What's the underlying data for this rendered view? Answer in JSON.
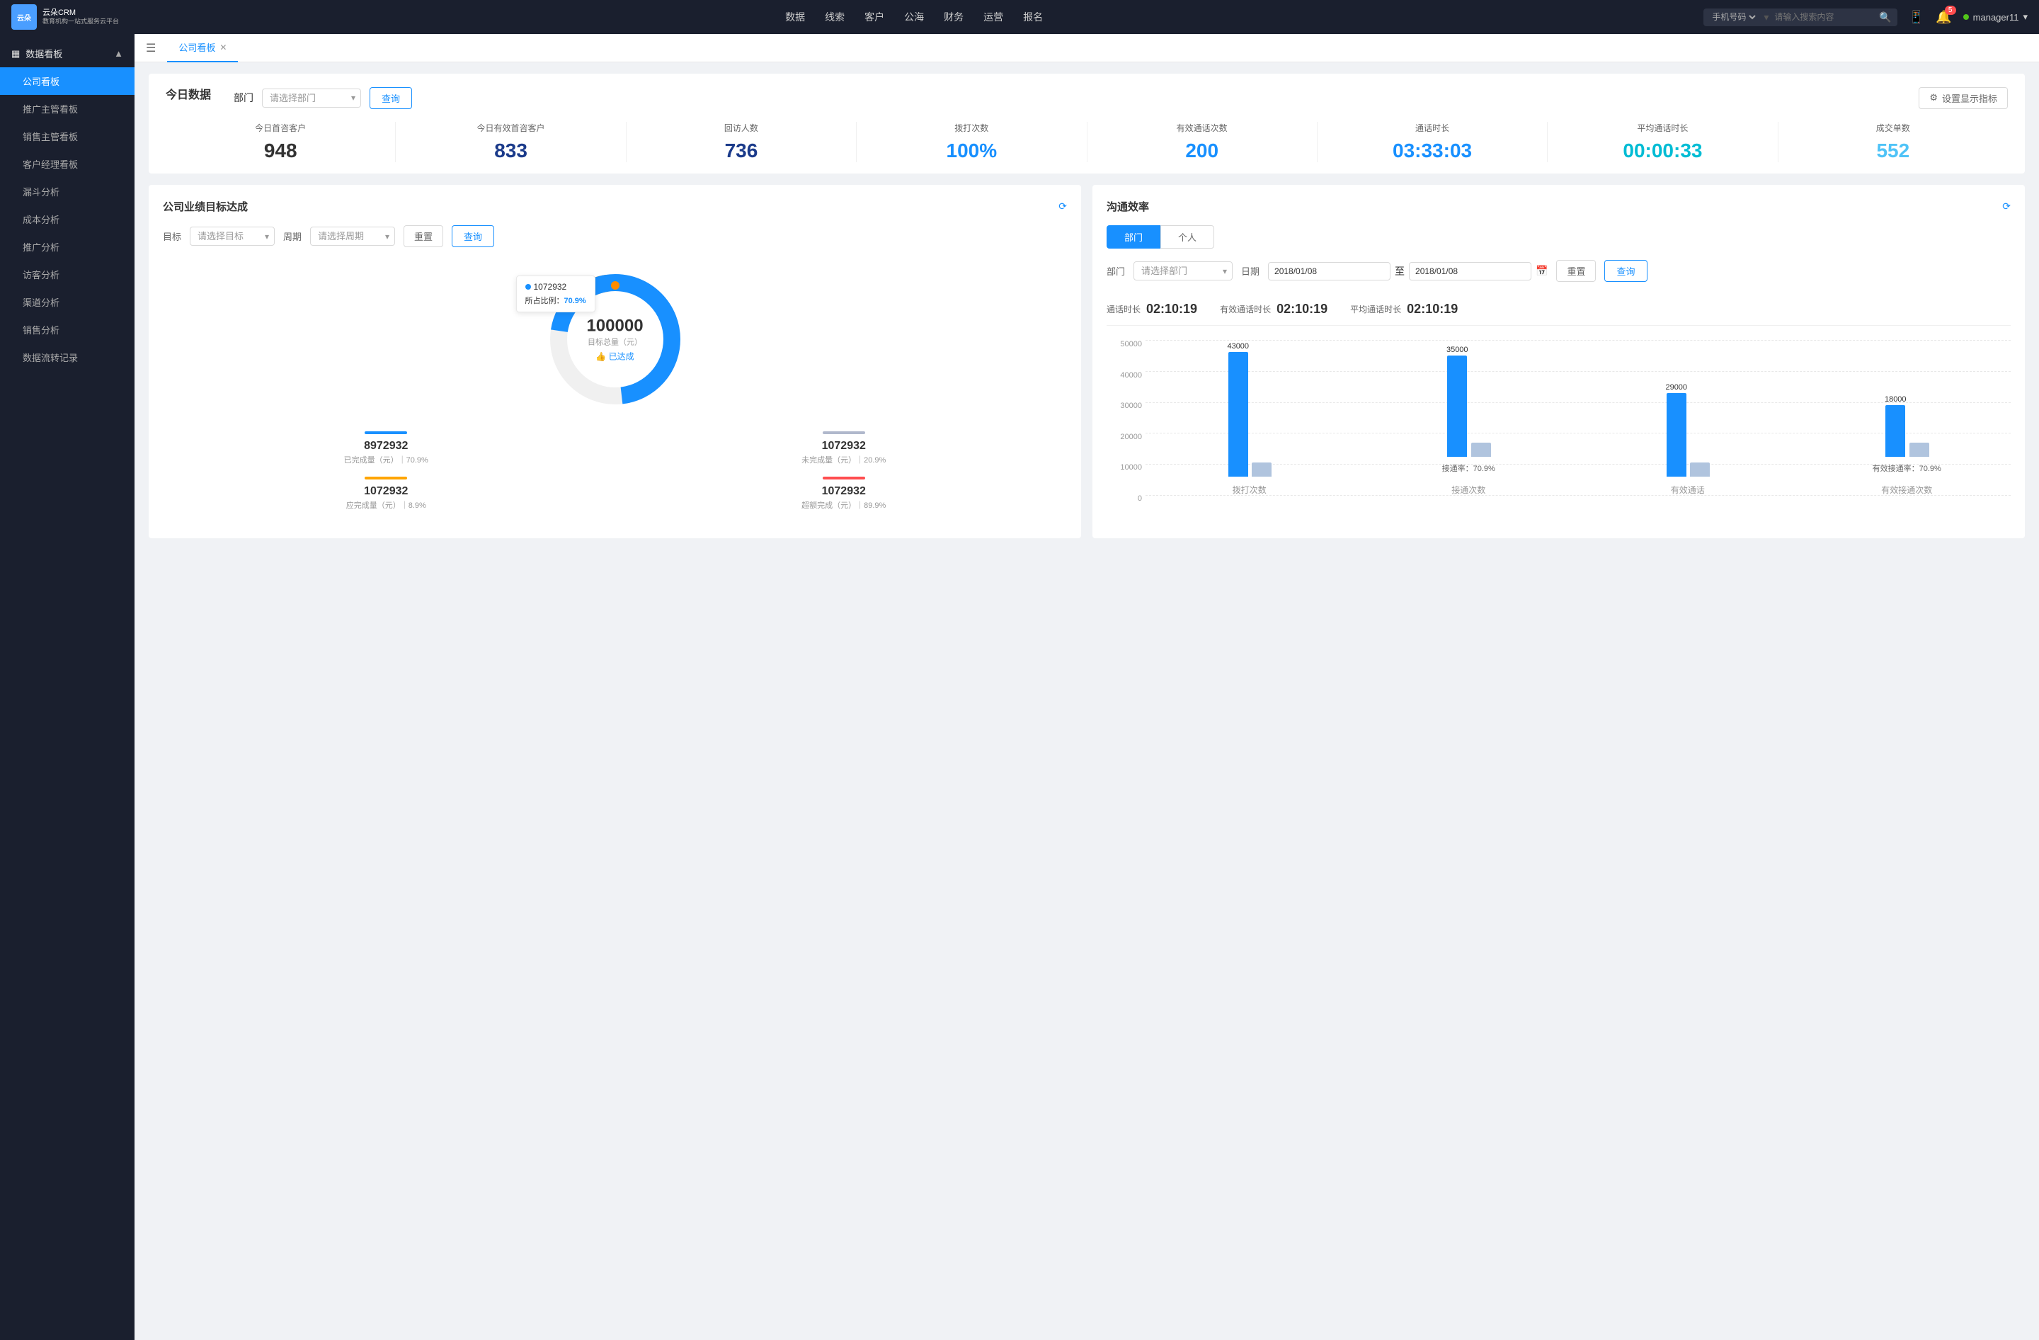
{
  "app": {
    "logo_text_line1": "云朵CRM",
    "logo_text_line2": "教育机构一站式服务云平台"
  },
  "top_nav": {
    "items": [
      "数据",
      "线索",
      "客户",
      "公海",
      "财务",
      "运营",
      "报名"
    ],
    "search_placeholder": "请输入搜索内容",
    "search_type": "手机号码",
    "notification_count": "5",
    "username": "manager11"
  },
  "sidebar": {
    "section_title": "数据看板",
    "items": [
      {
        "label": "公司看板",
        "active": true
      },
      {
        "label": "推广主管看板",
        "active": false
      },
      {
        "label": "销售主管看板",
        "active": false
      },
      {
        "label": "客户经理看板",
        "active": false
      },
      {
        "label": "漏斗分析",
        "active": false
      },
      {
        "label": "成本分析",
        "active": false
      },
      {
        "label": "推广分析",
        "active": false
      },
      {
        "label": "访客分析",
        "active": false
      },
      {
        "label": "渠道分析",
        "active": false
      },
      {
        "label": "销售分析",
        "active": false
      },
      {
        "label": "数据流转记录",
        "active": false
      }
    ]
  },
  "tab_bar": {
    "tabs": [
      {
        "label": "公司看板",
        "active": true
      }
    ]
  },
  "today_section": {
    "title": "今日数据",
    "dept_label": "部门",
    "dept_placeholder": "请选择部门",
    "query_btn": "查询",
    "settings_btn": "设置显示指标",
    "metrics": [
      {
        "label": "今日首咨客户",
        "value": "948",
        "color": "black"
      },
      {
        "label": "今日有效首咨客户",
        "value": "833",
        "color": "dark-blue"
      },
      {
        "label": "回访人数",
        "value": "736",
        "color": "dark-blue"
      },
      {
        "label": "拨打次数",
        "value": "100%",
        "color": "blue"
      },
      {
        "label": "有效通话次数",
        "value": "200",
        "color": "blue"
      },
      {
        "label": "通话时长",
        "value": "03:33:03",
        "color": "blue"
      },
      {
        "label": "平均通话时长",
        "value": "00:00:33",
        "color": "cyan"
      },
      {
        "label": "成交单数",
        "value": "552",
        "color": "light-blue"
      }
    ]
  },
  "target_panel": {
    "title": "公司业绩目标达成",
    "target_label": "目标",
    "target_placeholder": "请选择目标",
    "period_label": "周期",
    "period_placeholder": "请选择周期",
    "reset_btn": "重置",
    "query_btn": "查询",
    "donut": {
      "total": "100000",
      "total_label": "目标总量（元）",
      "achieved_label": "👍 已达成",
      "tooltip_value": "1072932",
      "tooltip_ratio_label": "所占比例：",
      "tooltip_ratio": "70.9%",
      "blue_pct": 70.9,
      "orange_pct": 9
    },
    "stats": [
      {
        "label": "已完成量（元）｜70.9%",
        "value": "8972932",
        "bar_color": "#1890ff"
      },
      {
        "label": "未完成量（元）｜20.9%",
        "value": "1072932",
        "bar_color": "#b0b8cc"
      },
      {
        "label": "应完成量（元）｜8.9%",
        "value": "1072932",
        "bar_color": "#ffa500"
      },
      {
        "label": "超额完成（元）｜89.9%",
        "value": "1072932",
        "bar_color": "#ff4d4f"
      }
    ]
  },
  "comm_panel": {
    "title": "沟通效率",
    "tabs": [
      "部门",
      "个人"
    ],
    "active_tab": 0,
    "dept_label": "部门",
    "dept_placeholder": "请选择部门",
    "date_label": "日期",
    "date_start": "2018/01/08",
    "date_end": "2018/01/08",
    "reset_btn": "重置",
    "query_btn": "查询",
    "stats": [
      {
        "label": "通话时长",
        "value": "02:10:19"
      },
      {
        "label": "有效通话时长",
        "value": "02:10:19"
      },
      {
        "label": "平均通话时长",
        "value": "02:10:19"
      }
    ],
    "chart": {
      "y_labels": [
        "50000",
        "40000",
        "30000",
        "20000",
        "10000",
        "0"
      ],
      "groups": [
        {
          "name": "拨打次数",
          "bars": [
            {
              "height": 176,
              "value": "43000",
              "color": "#1890ff"
            },
            {
              "height": 20,
              "value": "",
              "color": "#b0c4de"
            }
          ],
          "rate": ""
        },
        {
          "name": "接通次数",
          "bars": [
            {
              "height": 143,
              "value": "35000",
              "color": "#1890ff"
            },
            {
              "height": 20,
              "value": "",
              "color": "#b0c4de"
            }
          ],
          "rate": "接通率：70.9%"
        },
        {
          "name": "有效通话",
          "bars": [
            {
              "height": 118,
              "value": "29000",
              "color": "#1890ff"
            },
            {
              "height": 20,
              "value": "",
              "color": "#b0c4de"
            }
          ],
          "rate": ""
        },
        {
          "name": "有效接通次数",
          "bars": [
            {
              "height": 73,
              "value": "18000",
              "color": "#1890ff"
            },
            {
              "height": 20,
              "value": "",
              "color": "#b0c4de"
            }
          ],
          "rate": "有效接通率：70.9%"
        }
      ]
    }
  }
}
